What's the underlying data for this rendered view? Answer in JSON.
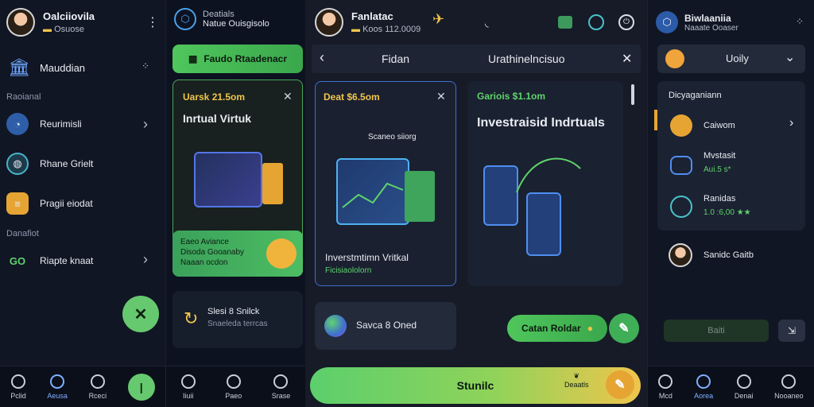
{
  "panel1": {
    "user_name": "Oalciiovila",
    "user_sub": "Osuose",
    "section1": "Mauddian",
    "group1": "Raoianal",
    "items": [
      {
        "label": "Reurimisli",
        "icon": "chart-icon"
      },
      {
        "label": "Rhane Grielt",
        "icon": "globe-icon"
      },
      {
        "label": "Pragii eiodat",
        "icon": "list-icon"
      }
    ],
    "group2": "Danafiot",
    "item4": "Riapte knaat",
    "nav": [
      "Pclid",
      "Aeusa",
      "Rceci"
    ]
  },
  "panel2": {
    "app_title": "Deatials",
    "app_sub": "Natue Ouisgisolo",
    "top_button": "Faudo Rtaadenacr",
    "card_price": "Uarsk 21.5om",
    "card_title": "Inrtual Virtuk",
    "promo_line1": "Eaeo Aviance",
    "promo_line2": "Disoda Gooanaby",
    "promo_line3": "Naaan ocdon",
    "list_title": "Slesi 8 Snilck",
    "list_sub": "Snaeleda terrcas",
    "nav": [
      "Iiuii",
      "Paeo",
      "Srase"
    ]
  },
  "panel3": {
    "user_name": "Fanlatac",
    "user_sub": "Koos 112.0009",
    "header_left": "Fidan",
    "header_title": "Urathinelncisuo",
    "card1_price": "Deat $6.5om",
    "card1_caption": "Scaneo siiorg",
    "card1_title": "Inverstmtimn Vritkal",
    "card1_sub": "Ficisiaololorn",
    "card2_price": "Gariois $1.1om",
    "card2_title": "Investraisid Indrtuals",
    "small_card_label": "Savca 8 Oned",
    "action_button": "Catan Roldar",
    "bottom_button": "Stunilc",
    "bottom_right_label": "Deaatls"
  },
  "panel4": {
    "user_name": "Biwlaaniia",
    "user_sub": "Naaate Ooaser",
    "select_value": "Uoily",
    "list_header": "Dicyaganiann",
    "rows": [
      {
        "title": "Caiwom",
        "sub": ""
      },
      {
        "title": "Mvstasit",
        "sub": "Aui.5 s*"
      },
      {
        "title": "Ranidas",
        "sub": "1.0 :6,00 ★★"
      }
    ],
    "contact": "Sanidc Gaitb",
    "dim_button": "Baiti",
    "nav": [
      "Mcd",
      "Aorea",
      "Denai",
      "Nooaneo"
    ]
  },
  "colors": {
    "accent_green": "#4fc65c",
    "accent_blue": "#3f6fd1",
    "accent_yellow": "#f0c54c"
  }
}
